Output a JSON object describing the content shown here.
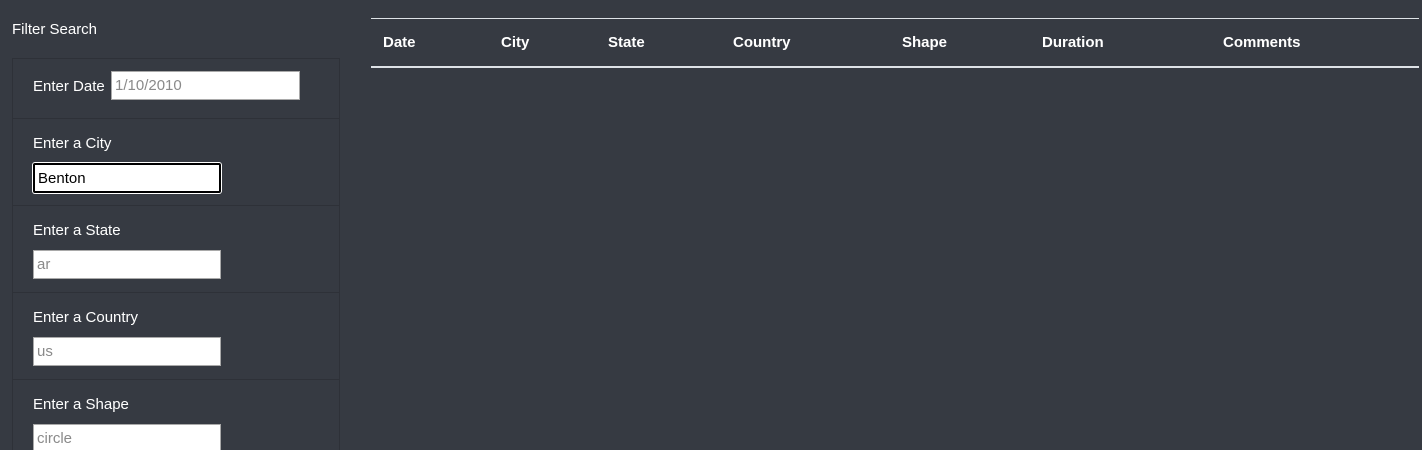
{
  "sidebar": {
    "title": "Filter Search",
    "filters": [
      {
        "label": "Enter Date",
        "placeholder": "1/10/2010",
        "value": ""
      },
      {
        "label": "Enter a City",
        "placeholder": "",
        "value": "Benton"
      },
      {
        "label": "Enter a State",
        "placeholder": "ar",
        "value": ""
      },
      {
        "label": "Enter a Country",
        "placeholder": "us",
        "value": ""
      },
      {
        "label": "Enter a Shape",
        "placeholder": "circle",
        "value": ""
      }
    ]
  },
  "table": {
    "columns": [
      "Date",
      "City",
      "State",
      "Country",
      "Shape",
      "Duration",
      "Comments"
    ]
  },
  "colors": {
    "background": "#363a42",
    "text": "#ffffff",
    "divider": "#dee2e6"
  }
}
